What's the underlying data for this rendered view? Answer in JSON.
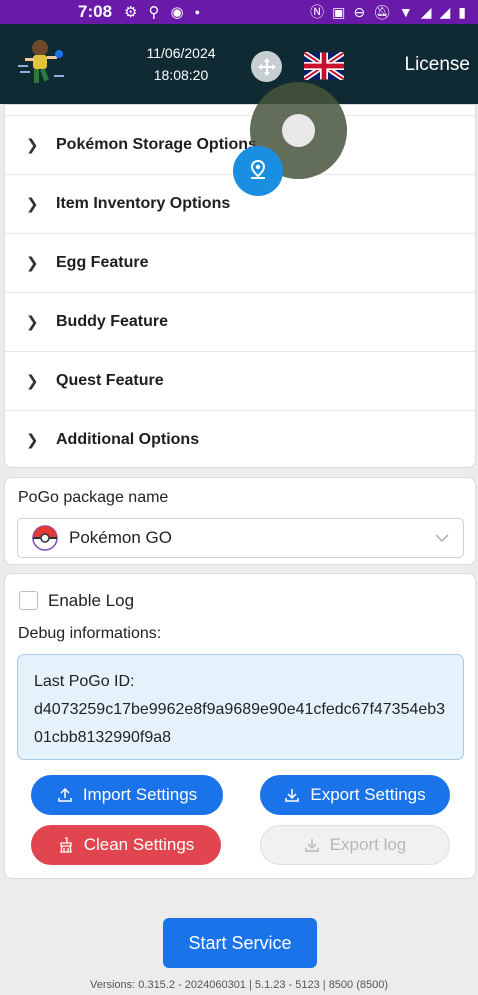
{
  "status_bar": {
    "time": "7:08"
  },
  "header": {
    "date": "11/06/2024",
    "time": "18:08:20",
    "license_label": "License"
  },
  "expand_items": [
    {
      "label": "Pokémon Storage Options"
    },
    {
      "label": "Item Inventory Options"
    },
    {
      "label": "Egg Feature"
    },
    {
      "label": "Buddy Feature"
    },
    {
      "label": "Quest Feature"
    },
    {
      "label": "Additional Options"
    }
  ],
  "package": {
    "label": "PoGo package name",
    "selected": "Pokémon GO"
  },
  "debug": {
    "enable_log_label": "Enable Log",
    "debug_label": "Debug informations:",
    "last_id_label": "Last PoGo ID:",
    "last_id_value": "d4073259c17be9962e8f9a9689e90e41cfedc67f47354eb301cbb8132990f9a8"
  },
  "buttons": {
    "import": "Import Settings",
    "export": "Export Settings",
    "clean": "Clean Settings",
    "export_log": "Export log",
    "start": "Start Service"
  },
  "versions": "Versions: 0.315.2 - 2024060301 | 5.1.23 - 5123 | 8500 (8500)",
  "colors": {
    "status_bar": "#6a1aa8",
    "header": "#0f2a33",
    "primary": "#1a73e8",
    "danger": "#e04550",
    "info_bg": "#e6f2fb"
  }
}
